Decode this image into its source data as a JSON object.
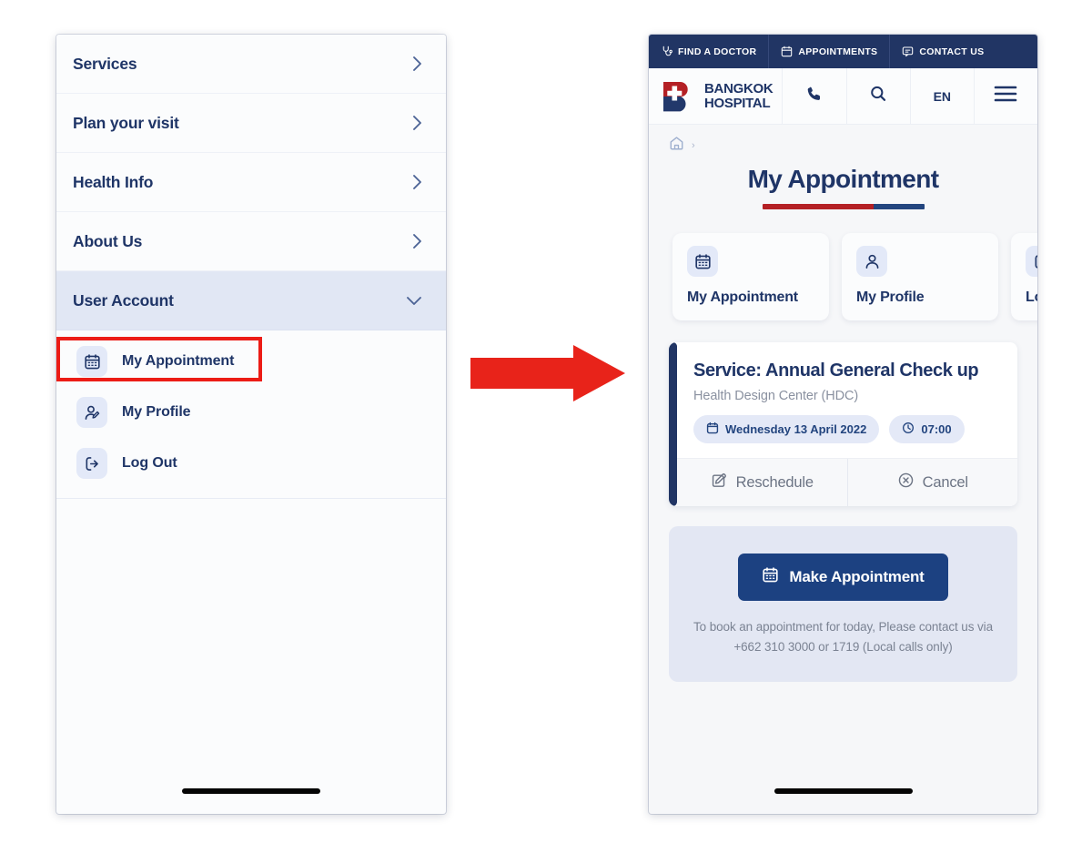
{
  "left_panel": {
    "menu": [
      {
        "label": "Services",
        "icon": "chevron-right-icon",
        "expanded": false
      },
      {
        "label": "Plan your visit",
        "icon": "chevron-right-icon",
        "expanded": false
      },
      {
        "label": "Health Info",
        "icon": "chevron-right-icon",
        "expanded": false
      },
      {
        "label": "About Us",
        "icon": "chevron-right-icon",
        "expanded": false
      },
      {
        "label": "User Account",
        "icon": "chevron-down-icon",
        "expanded": true
      }
    ],
    "submenu": [
      {
        "label": "My Appointment",
        "icon": "calendar-icon",
        "highlighted": true
      },
      {
        "label": "My Profile",
        "icon": "user-edit-icon",
        "highlighted": false
      },
      {
        "label": "Log Out",
        "icon": "logout-icon",
        "highlighted": false
      }
    ],
    "highlight_color": "#ec1c16"
  },
  "annotation": {
    "arrow": "right-arrow",
    "arrow_color": "#e8231a"
  },
  "right_panel": {
    "utility_bar": [
      {
        "label": "FIND A DOCTOR",
        "icon": "stethoscope-icon"
      },
      {
        "label": "APPOINTMENTS",
        "icon": "calendar-icon"
      },
      {
        "label": "CONTACT US",
        "icon": "chat-icon"
      }
    ],
    "header": {
      "logo_line1": "BANGKOK",
      "logo_line2": "HOSPITAL",
      "phone_icon": "phone-icon",
      "search_icon": "search-icon",
      "language": "EN",
      "menu_icon": "hamburger-menu-icon"
    },
    "breadcrumb": {
      "home_icon": "home-icon",
      "separator": "›"
    },
    "page_title": "My Appointment",
    "tabs": [
      {
        "label": "My Appointment",
        "icon": "calendar-icon",
        "active": true
      },
      {
        "label": "My Profile",
        "icon": "user-icon",
        "active": false
      },
      {
        "label": "Log Out",
        "icon": "logout-icon",
        "active": false
      }
    ],
    "appointment": {
      "service": "Service: Annual General Check up",
      "location": "Health Design Center (HDC)",
      "date": "Wednesday 13 April 2022",
      "date_icon": "calendar-icon",
      "time": "07:00",
      "time_icon": "clock-icon",
      "reschedule_label": "Reschedule",
      "reschedule_icon": "edit-icon",
      "cancel_label": "Cancel",
      "cancel_icon": "circle-x-icon"
    },
    "booking": {
      "button_label": "Make Appointment",
      "button_icon": "calendar-icon",
      "note": "To book an appointment for today, Please contact us via +662 310 3000 or 1719 (Local calls only)"
    },
    "colors": {
      "navy": "#213564",
      "brand_blue": "#1c4181",
      "brand_red": "#b42025",
      "pill_bg": "#e4e9f7"
    }
  }
}
